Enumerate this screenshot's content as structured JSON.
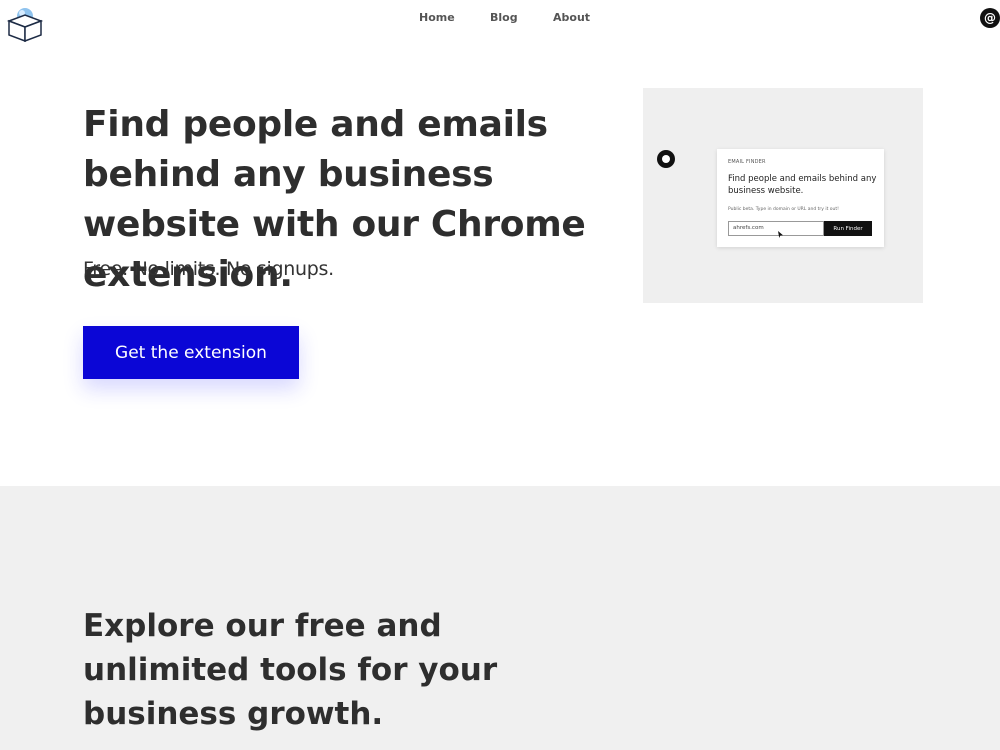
{
  "nav": {
    "home": "Home",
    "blog": "Blog",
    "about": "About"
  },
  "header": {
    "at_symbol": "@"
  },
  "hero": {
    "title": "Find people and emails behind any business website with our Chrome extension.",
    "subtitle": "Free. No limits. No signups.",
    "cta": "Get the extension"
  },
  "demo": {
    "label": "EMAIL FINDER",
    "title": "Find people and emails behind any business website.",
    "hint": "Public beta. Type in domain or URL and try it out!",
    "input_value": "ahrefs.com",
    "button": "Run Finder"
  },
  "section2": {
    "title": "Explore our free and unlimited tools for your business growth."
  },
  "colors": {
    "accent": "#0b06d6",
    "gray_band": "#f0f0f0",
    "text": "#2e2e2e"
  },
  "icons": {
    "logo": "open-box-logo-icon",
    "at": "at-sign-icon",
    "badge": "chrome-extension-icon",
    "cursor": "mouse-cursor-icon"
  }
}
